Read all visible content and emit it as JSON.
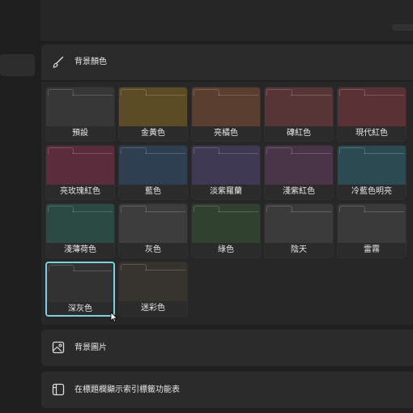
{
  "sections": {
    "background_color": "背景顏色",
    "background_image": "背景圖片",
    "tab_menu": "在標題欄顯示索引標籤功能表"
  },
  "swatches": [
    {
      "label": "預設",
      "color": "#373737",
      "selected": false
    },
    {
      "label": "金黃色",
      "color": "#5c4c26",
      "selected": false
    },
    {
      "label": "亮橘色",
      "color": "#5a3e30",
      "selected": false
    },
    {
      "label": "磚紅色",
      "color": "#573435",
      "selected": false
    },
    {
      "label": "現代紅色",
      "color": "#5a3236",
      "selected": false
    },
    {
      "label": "亮玫瑰紅色",
      "color": "#5a2c3c",
      "selected": false
    },
    {
      "label": "藍色",
      "color": "#2e3f52",
      "selected": false
    },
    {
      "label": "淡紫羅蘭",
      "color": "#3f3953",
      "selected": false
    },
    {
      "label": "淺紫紅色",
      "color": "#4a3448",
      "selected": false
    },
    {
      "label": "冷藍色明亮",
      "color": "#2c4a52",
      "selected": false
    },
    {
      "label": "淺薄荷色",
      "color": "#2c4a44",
      "selected": false
    },
    {
      "label": "灰色",
      "color": "#3d3d3d",
      "selected": false
    },
    {
      "label": "綠色",
      "color": "#30412f",
      "selected": false
    },
    {
      "label": "陰天",
      "color": "#3b3b3b",
      "selected": false
    },
    {
      "label": "雷霧",
      "color": "#3a3a3a",
      "selected": false
    },
    {
      "label": "深灰色",
      "color": "#323232",
      "selected": true
    },
    {
      "label": "迷彩色",
      "color": "#37332f",
      "selected": false
    }
  ]
}
